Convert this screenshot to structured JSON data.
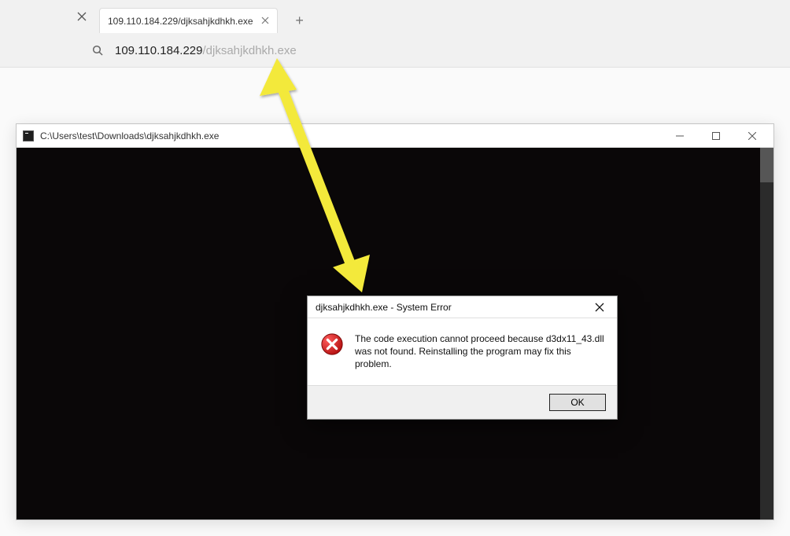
{
  "browser": {
    "tab_title": "109.110.184.229/djksahjkdhkh.exe",
    "address_host": "109.110.184.229",
    "address_path": "/djksahjkdhkh.exe"
  },
  "console": {
    "title": "C:\\Users\\test\\Downloads\\djksahjkdhkh.exe"
  },
  "dialog": {
    "title": "djksahjkdhkh.exe - System Error",
    "message": "The code execution cannot proceed because d3dx11_43.dll was not found. Reinstalling the program may fix this problem.",
    "ok_label": "OK"
  },
  "colors": {
    "arrow": "#f3e93a"
  }
}
